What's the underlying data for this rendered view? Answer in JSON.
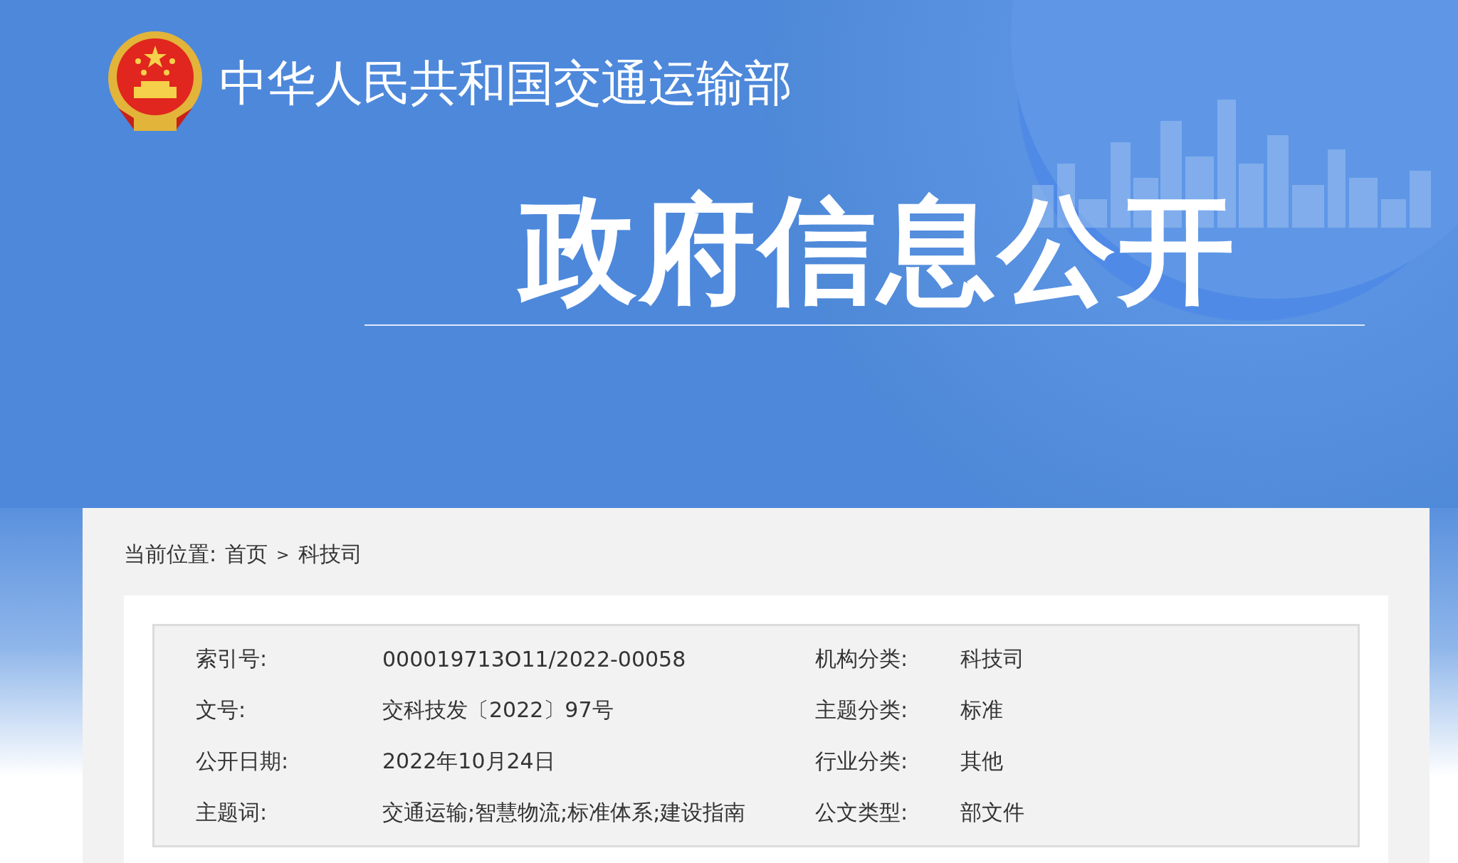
{
  "header": {
    "site_title": "中华人民共和国交通运输部",
    "banner_title": "政府信息公开"
  },
  "breadcrumb": {
    "label": "当前位置:",
    "items": [
      "首页",
      "科技司"
    ],
    "separator": ">"
  },
  "info_rows": [
    [
      {
        "label": "索引号:",
        "value": "000019713O11/2022-00058"
      },
      {
        "label": "机构分类:",
        "value": "科技司"
      }
    ],
    [
      {
        "label": "文号:",
        "value": "交科技发〔2022〕97号"
      },
      {
        "label": "主题分类:",
        "value": "标准"
      }
    ],
    [
      {
        "label": "公开日期:",
        "value": "2022年10月24日"
      },
      {
        "label": "行业分类:",
        "value": "其他"
      }
    ],
    [
      {
        "label": "主题词:",
        "value": "交通运输;智慧物流;标准体系;建设指南"
      },
      {
        "label": "公文类型:",
        "value": "部文件"
      }
    ]
  ]
}
